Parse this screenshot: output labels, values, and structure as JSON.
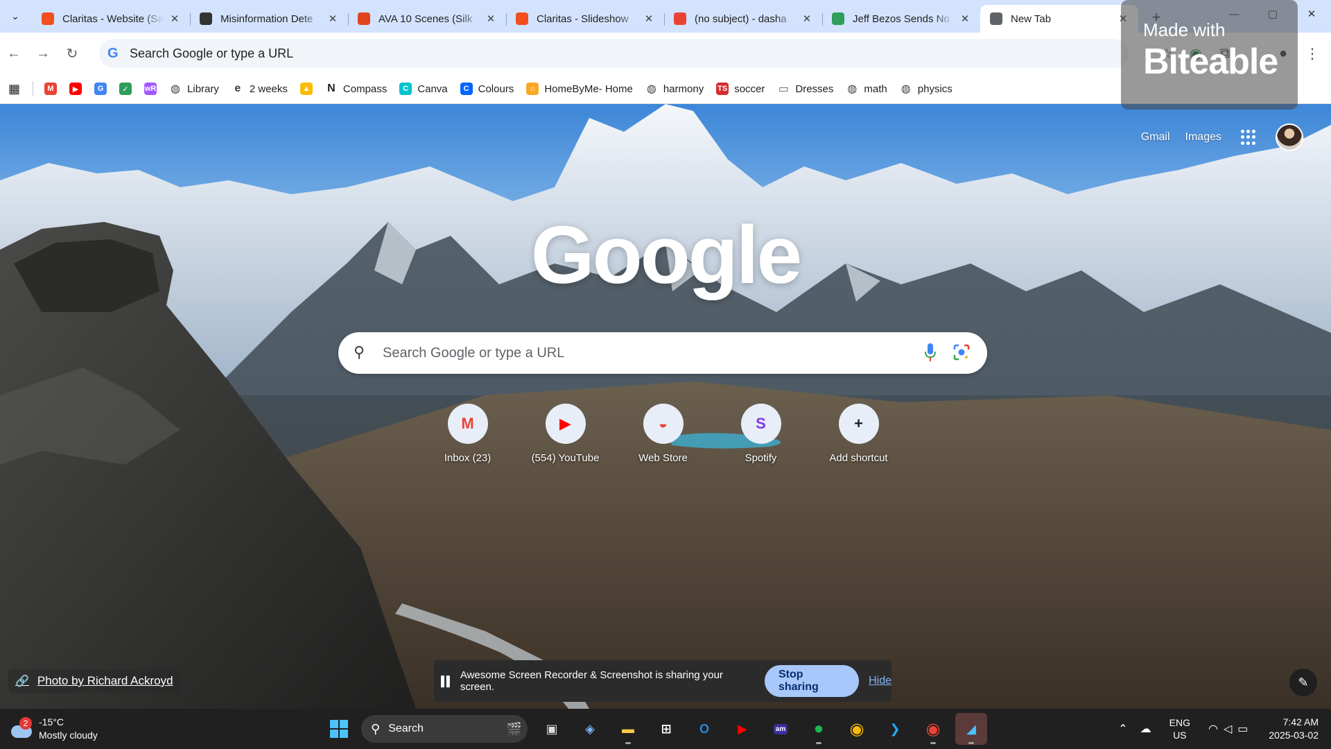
{
  "tabs": [
    {
      "title": "Claritas - Website (Sa",
      "favicon": "figma-icon",
      "color": "#f24e1e",
      "active": false
    },
    {
      "title": "Misinformation Dete",
      "favicon": "openai-icon",
      "color": "#333333",
      "active": false
    },
    {
      "title": "AVA 10 Scenes (Silk",
      "favicon": "adobe-icon",
      "color": "#e34420",
      "active": false
    },
    {
      "title": "Claritas - Slideshow",
      "favicon": "figma-icon",
      "color": "#f24e1e",
      "active": false
    },
    {
      "title": "(no subject) - dasha",
      "favicon": "gmail-icon",
      "color": "#ea4335",
      "active": false
    },
    {
      "title": "Jeff Bezos Sends No",
      "favicon": "leaf-icon",
      "color": "#2e9e5b",
      "active": false
    },
    {
      "title": "New Tab",
      "favicon": "chrome-icon",
      "color": "#5f6368",
      "active": true
    }
  ],
  "toolbar": {
    "omnibox_text": "Search Google or type a URL"
  },
  "bookmarks": [
    {
      "label": "",
      "icon": "gmail-icon",
      "color": "#ea4335",
      "glyph": "M"
    },
    {
      "label": "",
      "icon": "youtube-icon",
      "color": "#ff0000",
      "glyph": "▶"
    },
    {
      "label": "",
      "icon": "translate-icon",
      "color": "#4285f4",
      "glyph": "G"
    },
    {
      "label": "",
      "icon": "check-icon",
      "color": "#2e9e5b",
      "glyph": "✓"
    },
    {
      "label": "",
      "icon": "wordreference-icon",
      "color": "#a259ff",
      "glyph": "wR"
    },
    {
      "label": "Library",
      "icon": "globe-icon",
      "color": "#3c4043",
      "glyph": "◍"
    },
    {
      "label": "2 weeks",
      "icon": "edpuzzle-icon",
      "color": "#3c4043",
      "glyph": "e"
    },
    {
      "label": "",
      "icon": "drive-icon",
      "color": "#fbbc04",
      "glyph": "▲"
    },
    {
      "label": "Compass",
      "icon": "notion-icon",
      "color": "#1f1f1f",
      "glyph": "N"
    },
    {
      "label": "Canva",
      "icon": "canva-icon",
      "color": "#00c4cc",
      "glyph": "C"
    },
    {
      "label": "Colours",
      "icon": "coolors-icon",
      "color": "#0066ff",
      "glyph": "C"
    },
    {
      "label": "HomeByMe- Home",
      "icon": "homebyme-icon",
      "color": "#f9a825",
      "glyph": "⌂"
    },
    {
      "label": "harmony",
      "icon": "globe-icon",
      "color": "#3c4043",
      "glyph": "◍"
    },
    {
      "label": "soccer",
      "icon": "ts-icon",
      "color": "#d32f2f",
      "glyph": "TS"
    },
    {
      "label": "Dresses",
      "icon": "folder-icon",
      "color": "#5f6368",
      "glyph": "▭"
    },
    {
      "label": "math",
      "icon": "globe-icon",
      "color": "#3c4043",
      "glyph": "◍"
    },
    {
      "label": "physics",
      "icon": "globe-icon",
      "color": "#3c4043",
      "glyph": "◍"
    }
  ],
  "ntp": {
    "gmail_link": "Gmail",
    "images_link": "Images",
    "logo_text": "Google",
    "search_placeholder": "Search Google or type a URL",
    "shortcuts": [
      {
        "label": "Inbox (23)",
        "icon": "gmail-icon",
        "glyph": "M",
        "color": "#ea4335"
      },
      {
        "label": "(554) YouTube",
        "icon": "youtube-icon",
        "glyph": "▶",
        "color": "#ff0000"
      },
      {
        "label": "Web Store",
        "icon": "chrome-web-store-icon",
        "glyph": "◒",
        "color": "#ea4335"
      },
      {
        "label": "Spotify",
        "icon": "spotify-avatar-icon",
        "glyph": "S",
        "color": "#7c3aed"
      },
      {
        "label": "Add shortcut",
        "icon": "plus-icon",
        "glyph": "+",
        "color": "#1f1f1f"
      }
    ],
    "photo_credit": "Photo by Richard Ackroyd"
  },
  "share_bar": {
    "message": "Awesome Screen Recorder & Screenshot is sharing your screen.",
    "stop_label": "Stop sharing",
    "hide_label": "Hide"
  },
  "watermark": {
    "made_with": "Made with",
    "brand": "Biteable"
  },
  "taskbar": {
    "weather_temp": "-15°C",
    "weather_desc": "Mostly cloudy",
    "weather_badge": "2",
    "search_label": "Search",
    "lang_line1": "ENG",
    "lang_line2": "US",
    "time": "7:42 AM",
    "date": "2025-03-02"
  }
}
